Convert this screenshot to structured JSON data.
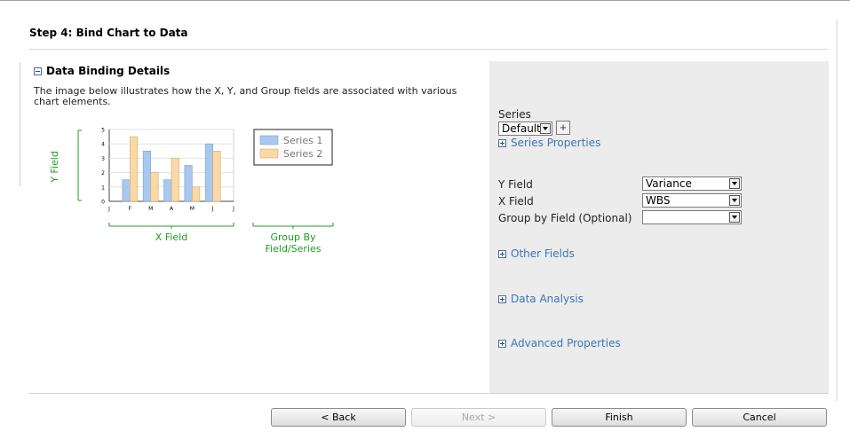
{
  "step_title": "Step 4: Bind Chart to Data",
  "section": {
    "title": "Data Binding Details",
    "description": "The image below illustrates how the X, Y, and Group fields are associated with various chart elements."
  },
  "illustration": {
    "y_field_label": "Y Field",
    "x_field_label": "X Field",
    "group_label_line1": "Group By",
    "group_label_line2": "Field/Series",
    "colors": {
      "series1": "#a9c8ef",
      "series2": "#fad9a6",
      "guide": "#1f9c1f"
    }
  },
  "chart_data": {
    "type": "bar",
    "categories": [
      "J",
      "F",
      "M",
      "A",
      "M",
      "J",
      "J"
    ],
    "ylim": [
      0,
      5
    ],
    "y_ticks": [
      "0",
      "1",
      "2",
      "3",
      "4",
      "5"
    ],
    "series": [
      {
        "name": "Series 1",
        "values": [
          null,
          1.5,
          3.5,
          1.5,
          2.5,
          4,
          null
        ]
      },
      {
        "name": "Series 2",
        "values": [
          null,
          4.5,
          2,
          3,
          1,
          3.5,
          null
        ]
      }
    ],
    "legend": "right"
  },
  "series": {
    "label": "Series",
    "selected": "Default",
    "add_label": "+",
    "properties_link": "Series Properties"
  },
  "fields": {
    "y_label": "Y Field",
    "y_value": "Variance",
    "x_label": "X Field",
    "x_value": "WBS",
    "group_label": "Group by Field (Optional)",
    "group_value": ""
  },
  "links": {
    "other_fields": "Other Fields",
    "data_analysis": "Data Analysis",
    "advanced_properties": "Advanced Properties"
  },
  "buttons": {
    "back": "< Back",
    "next": "Next >",
    "finish": "Finish",
    "cancel": "Cancel"
  }
}
